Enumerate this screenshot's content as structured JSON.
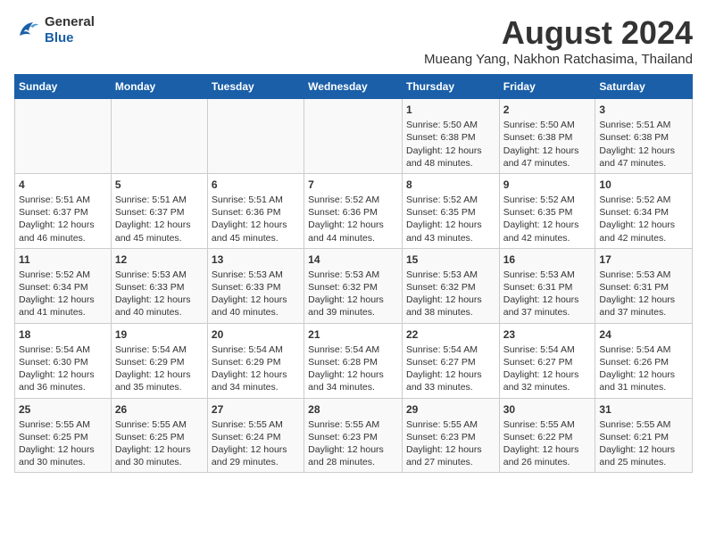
{
  "logo": {
    "line1": "General",
    "line2": "Blue"
  },
  "title": "August 2024",
  "subtitle": "Mueang Yang, Nakhon Ratchasima, Thailand",
  "headers": [
    "Sunday",
    "Monday",
    "Tuesday",
    "Wednesday",
    "Thursday",
    "Friday",
    "Saturday"
  ],
  "weeks": [
    [
      {
        "day": "",
        "content": ""
      },
      {
        "day": "",
        "content": ""
      },
      {
        "day": "",
        "content": ""
      },
      {
        "day": "",
        "content": ""
      },
      {
        "day": "1",
        "content": "Sunrise: 5:50 AM\nSunset: 6:38 PM\nDaylight: 12 hours and 48 minutes."
      },
      {
        "day": "2",
        "content": "Sunrise: 5:50 AM\nSunset: 6:38 PM\nDaylight: 12 hours and 47 minutes."
      },
      {
        "day": "3",
        "content": "Sunrise: 5:51 AM\nSunset: 6:38 PM\nDaylight: 12 hours and 47 minutes."
      }
    ],
    [
      {
        "day": "4",
        "content": "Sunrise: 5:51 AM\nSunset: 6:37 PM\nDaylight: 12 hours and 46 minutes."
      },
      {
        "day": "5",
        "content": "Sunrise: 5:51 AM\nSunset: 6:37 PM\nDaylight: 12 hours and 45 minutes."
      },
      {
        "day": "6",
        "content": "Sunrise: 5:51 AM\nSunset: 6:36 PM\nDaylight: 12 hours and 45 minutes."
      },
      {
        "day": "7",
        "content": "Sunrise: 5:52 AM\nSunset: 6:36 PM\nDaylight: 12 hours and 44 minutes."
      },
      {
        "day": "8",
        "content": "Sunrise: 5:52 AM\nSunset: 6:35 PM\nDaylight: 12 hours and 43 minutes."
      },
      {
        "day": "9",
        "content": "Sunrise: 5:52 AM\nSunset: 6:35 PM\nDaylight: 12 hours and 42 minutes."
      },
      {
        "day": "10",
        "content": "Sunrise: 5:52 AM\nSunset: 6:34 PM\nDaylight: 12 hours and 42 minutes."
      }
    ],
    [
      {
        "day": "11",
        "content": "Sunrise: 5:52 AM\nSunset: 6:34 PM\nDaylight: 12 hours and 41 minutes."
      },
      {
        "day": "12",
        "content": "Sunrise: 5:53 AM\nSunset: 6:33 PM\nDaylight: 12 hours and 40 minutes."
      },
      {
        "day": "13",
        "content": "Sunrise: 5:53 AM\nSunset: 6:33 PM\nDaylight: 12 hours and 40 minutes."
      },
      {
        "day": "14",
        "content": "Sunrise: 5:53 AM\nSunset: 6:32 PM\nDaylight: 12 hours and 39 minutes."
      },
      {
        "day": "15",
        "content": "Sunrise: 5:53 AM\nSunset: 6:32 PM\nDaylight: 12 hours and 38 minutes."
      },
      {
        "day": "16",
        "content": "Sunrise: 5:53 AM\nSunset: 6:31 PM\nDaylight: 12 hours and 37 minutes."
      },
      {
        "day": "17",
        "content": "Sunrise: 5:53 AM\nSunset: 6:31 PM\nDaylight: 12 hours and 37 minutes."
      }
    ],
    [
      {
        "day": "18",
        "content": "Sunrise: 5:54 AM\nSunset: 6:30 PM\nDaylight: 12 hours and 36 minutes."
      },
      {
        "day": "19",
        "content": "Sunrise: 5:54 AM\nSunset: 6:29 PM\nDaylight: 12 hours and 35 minutes."
      },
      {
        "day": "20",
        "content": "Sunrise: 5:54 AM\nSunset: 6:29 PM\nDaylight: 12 hours and 34 minutes."
      },
      {
        "day": "21",
        "content": "Sunrise: 5:54 AM\nSunset: 6:28 PM\nDaylight: 12 hours and 34 minutes."
      },
      {
        "day": "22",
        "content": "Sunrise: 5:54 AM\nSunset: 6:27 PM\nDaylight: 12 hours and 33 minutes."
      },
      {
        "day": "23",
        "content": "Sunrise: 5:54 AM\nSunset: 6:27 PM\nDaylight: 12 hours and 32 minutes."
      },
      {
        "day": "24",
        "content": "Sunrise: 5:54 AM\nSunset: 6:26 PM\nDaylight: 12 hours and 31 minutes."
      }
    ],
    [
      {
        "day": "25",
        "content": "Sunrise: 5:55 AM\nSunset: 6:25 PM\nDaylight: 12 hours and 30 minutes."
      },
      {
        "day": "26",
        "content": "Sunrise: 5:55 AM\nSunset: 6:25 PM\nDaylight: 12 hours and 30 minutes."
      },
      {
        "day": "27",
        "content": "Sunrise: 5:55 AM\nSunset: 6:24 PM\nDaylight: 12 hours and 29 minutes."
      },
      {
        "day": "28",
        "content": "Sunrise: 5:55 AM\nSunset: 6:23 PM\nDaylight: 12 hours and 28 minutes."
      },
      {
        "day": "29",
        "content": "Sunrise: 5:55 AM\nSunset: 6:23 PM\nDaylight: 12 hours and 27 minutes."
      },
      {
        "day": "30",
        "content": "Sunrise: 5:55 AM\nSunset: 6:22 PM\nDaylight: 12 hours and 26 minutes."
      },
      {
        "day": "31",
        "content": "Sunrise: 5:55 AM\nSunset: 6:21 PM\nDaylight: 12 hours and 25 minutes."
      }
    ]
  ]
}
